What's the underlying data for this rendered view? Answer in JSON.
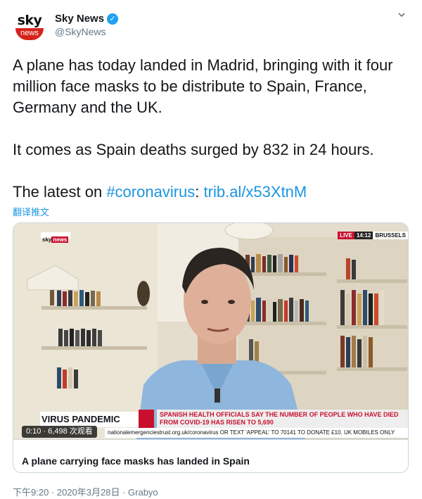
{
  "tweet": {
    "display_name": "Sky News",
    "handle": "@SkyNews",
    "avatar": {
      "top": "sky",
      "bottom": "news"
    },
    "verified_icon": "verified-badge-icon",
    "caret_icon": "chevron-down-icon",
    "text_line1": "A plane has today landed in Madrid, bringing with it four million face masks to be distribute to Spain, France, Germany and the UK.",
    "text_line2": "It comes as Spain deaths surged by 832 in 24 hours.",
    "text_line3_prefix": "The latest on ",
    "hashtag": "#coronavirus",
    "colon": ":",
    "link": "trib.al/x53XtnM",
    "translate_label": "翻译推文",
    "timestamp": "下午9:20 · 2020年3月28日 · Grabyo"
  },
  "video_card": {
    "overlay": {
      "channel_sky": "sky",
      "channel_news": "news",
      "live": "LIVE",
      "time": "14:12",
      "location": "BRUSSELS",
      "section": "VIRUS PANDEMIC",
      "headline": "SPANISH HEALTH OFFICIALS SAY THE NUMBER OF PEOPLE WHO HAVE DIED FROM COVID-19 HAS RISEN TO 5,690",
      "ticker": "nationalemergenciestrust.org.uk/coronavirus OR TEXT 'APPEAL' TO 70141 TO DONATE £10. UK MOBILES ONLY"
    },
    "play_info": "0:10 · 6,498 次观看",
    "title": "A plane carrying face masks has landed in Spain"
  },
  "colors": {
    "link": "#1b95e0",
    "sky_red": "#c8102e",
    "verified": "#1da1f2",
    "muted": "#657786"
  }
}
